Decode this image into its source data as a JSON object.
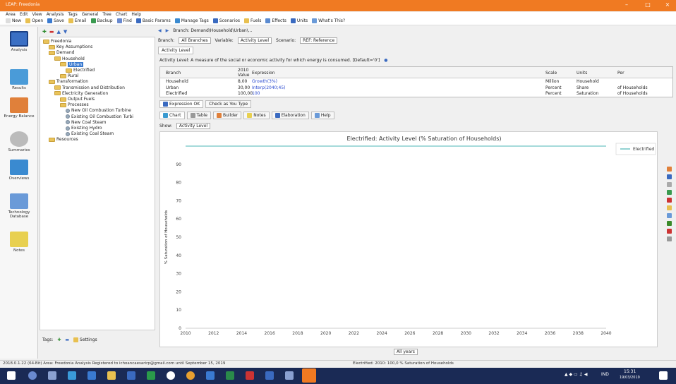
{
  "window": {
    "title": "LEAP: Freedonia",
    "minimize": "–",
    "maximize": "□",
    "close": "×"
  },
  "menu": [
    "Area",
    "Edit",
    "View",
    "Analysis",
    "Tags",
    "General",
    "Tree",
    "Chart",
    "Help"
  ],
  "toolbar": [
    "New",
    "Open",
    "Save",
    "Email",
    "Backup",
    "Find",
    "Basic Params",
    "Manage Tags",
    "Scenarios",
    "Fuels",
    "Effects",
    "Units",
    "What's This?"
  ],
  "sidebar": [
    {
      "label": "Analysis",
      "icon": "analysis-icon",
      "color": "#3a6fc4"
    },
    {
      "label": "Results",
      "icon": "results-icon",
      "color": "#4a9bd8"
    },
    {
      "label": "Energy Balance",
      "icon": "energy-balance-icon",
      "color": "#e0803a"
    },
    {
      "label": "Summaries",
      "icon": "summaries-icon",
      "color": "#888888"
    },
    {
      "label": "Overviews",
      "icon": "overviews-icon",
      "color": "#3a8ad0"
    },
    {
      "label": "Technology Database",
      "icon": "technology-database-icon",
      "color": "#6a9ad8"
    },
    {
      "label": "Notes",
      "icon": "notes-icon",
      "color": "#e8d050"
    }
  ],
  "tree": [
    {
      "label": "Freedonia",
      "indent": 0,
      "type": "folder"
    },
    {
      "label": "Key Assumptions",
      "indent": 1,
      "type": "folder"
    },
    {
      "label": "Demand",
      "indent": 1,
      "type": "folder"
    },
    {
      "label": "Household",
      "indent": 2,
      "type": "folder"
    },
    {
      "label": "Urban",
      "indent": 3,
      "type": "folder",
      "selected": true
    },
    {
      "label": "Electrified",
      "indent": 4,
      "type": "folder"
    },
    {
      "label": "Rural",
      "indent": 3,
      "type": "folder"
    },
    {
      "label": "Transformation",
      "indent": 1,
      "type": "folder"
    },
    {
      "label": "Transmission and Distribution",
      "indent": 2,
      "type": "folder"
    },
    {
      "label": "Electricity Generation",
      "indent": 2,
      "type": "folder"
    },
    {
      "label": "Output Fuels",
      "indent": 3,
      "type": "folder"
    },
    {
      "label": "Processes",
      "indent": 3,
      "type": "folder"
    },
    {
      "label": "New Oil Combustion Turbine",
      "indent": 4,
      "type": "leaf"
    },
    {
      "label": "Existing Oil Combustion Turbi",
      "indent": 4,
      "type": "leaf"
    },
    {
      "label": "New Coal Steam",
      "indent": 4,
      "type": "leaf"
    },
    {
      "label": "Existing Hydro",
      "indent": 4,
      "type": "leaf"
    },
    {
      "label": "Existing Coal Steam",
      "indent": 4,
      "type": "leaf"
    },
    {
      "label": "Resources",
      "indent": 1,
      "type": "folder"
    }
  ],
  "tree_bottom": {
    "tags": "Tags:",
    "settings": "Settings"
  },
  "branch_bar": {
    "branch_label": "Branch:",
    "branch_value": "All Branches",
    "variable_label": "Variable:",
    "variable_value": "Activity Level",
    "scenario_label": "Scenario:",
    "scenario_value": "REF: Reference",
    "path": "Branch: Demand\\Household\\Urban\\..."
  },
  "activity_tab": "Activity Level",
  "description": "Activity Level: A measure of the social or economic activity for which energy is consumed. [Default='0']",
  "grid": {
    "headers": {
      "branch": "Branch",
      "value_year": "2010",
      "value": "Value",
      "expression": "Expression",
      "scale": "Scale",
      "units": "Units",
      "per": "Per"
    },
    "rows": [
      {
        "branch": "Household",
        "value": "8,00",
        "expression": "Growth(3%)",
        "scale": "Million",
        "units": "Household",
        "per": ""
      },
      {
        "branch": "Urban",
        "value": "30,00",
        "expression": "Interp(2040;45)",
        "scale": "Percent",
        "units": "Share",
        "per": "of Households"
      },
      {
        "branch": "Electrified",
        "value": "100,00",
        "expression": "100",
        "scale": "Percent",
        "units": "Saturation",
        "per": "of Households"
      }
    ]
  },
  "status_tabs": [
    "Expression OK",
    "Check as You Type"
  ],
  "view_tabs": [
    "Chart",
    "Table",
    "Builder",
    "Notes",
    "Elaboration",
    "Help"
  ],
  "show": {
    "label": "Show:",
    "value": "Activity Level"
  },
  "year_select": "All years",
  "chart_data": {
    "type": "line",
    "title": "Electrified: Activity Level (% Saturation of Households)",
    "ylabel": "% Saturation of Households",
    "xlabel": "",
    "x": [
      2010,
      2012,
      2014,
      2016,
      2018,
      2020,
      2022,
      2024,
      2026,
      2028,
      2030,
      2032,
      2034,
      2036,
      2038,
      2040
    ],
    "ylim": [
      0,
      100
    ],
    "yticks": [
      0,
      10,
      20,
      30,
      40,
      50,
      60,
      70,
      80,
      90
    ],
    "series": [
      {
        "name": "Electrified",
        "values": [
          100,
          100,
          100,
          100,
          100,
          100,
          100,
          100,
          100,
          100,
          100,
          100,
          100,
          100,
          100,
          100
        ],
        "color": "#4bb4b4"
      }
    ],
    "legend": "top-right"
  },
  "statusbar": {
    "left": "2018.0.1.22 (64-Bit)   Area: Freedonia   Analysis   Registered to ichoancaesarirp@gmail.com until September 15, 2019",
    "right": "Electrified: 2010: 100,0 % Saturation of Households"
  },
  "taskbar": {
    "lang": "IND",
    "time": "15:31",
    "date": "19/03/2019"
  }
}
